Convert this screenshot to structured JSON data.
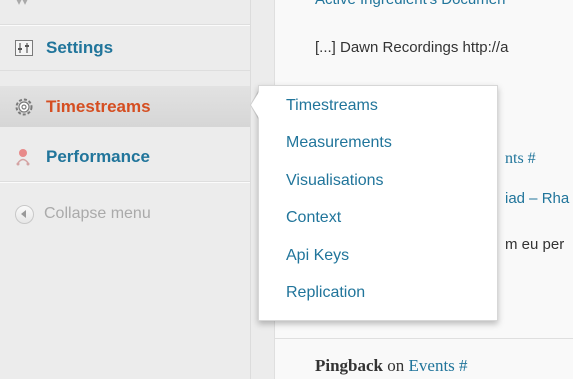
{
  "sidebar": {
    "items": [
      {
        "label": "Settings",
        "icon": "settings-icon"
      },
      {
        "label": "Timestreams",
        "icon": "timestreams-gear-icon",
        "active": true
      },
      {
        "label": "Performance",
        "icon": "performance-icon"
      }
    ],
    "collapse_label": "Collapse menu"
  },
  "flyout": {
    "items": [
      "Timestreams",
      "Measurements",
      "Visualisations",
      "Context",
      "Api Keys",
      "Replication"
    ]
  },
  "content": {
    "top_partial": "Active Ingredient's Documen",
    "comment1_text": "[...] Dawn Recordings http://a",
    "events_partial": "nts #",
    "iad_partial": "iad – Rha",
    "meu_partial": "m eu per",
    "pingback_label": "Pingback",
    "pingback_on": "on",
    "pingback_link": "Events #"
  },
  "colors": {
    "link": "#21759b",
    "active": "#d54e21",
    "sidebar_bg": "#ececec"
  }
}
